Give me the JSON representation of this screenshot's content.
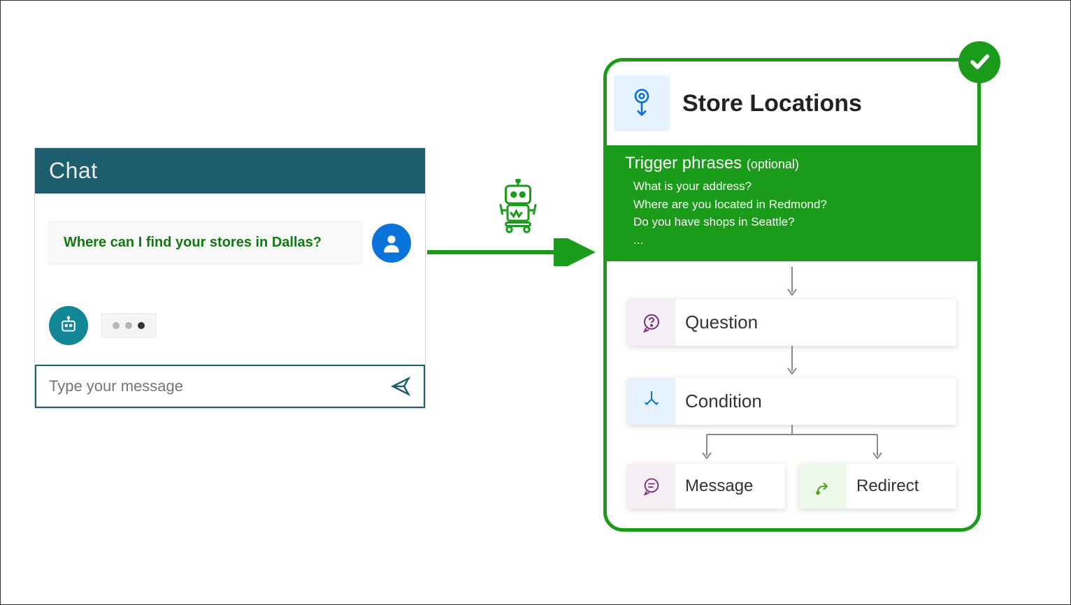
{
  "chat": {
    "title": "Chat",
    "user_message": "Where can I find your stores in Dallas?",
    "input_placeholder": "Type your message"
  },
  "flow": {
    "title": "Store Locations",
    "trigger_heading": "Trigger phrases",
    "trigger_optional": "(optional)",
    "triggers": [
      "What is your address?",
      "Where are you located in Redmond?",
      "Do you have shops in Seattle?",
      "..."
    ],
    "nodes": {
      "question": "Question",
      "condition": "Condition",
      "message": "Message",
      "redirect": "Redirect"
    }
  },
  "icons": {
    "user": "user",
    "bot": "bot",
    "send": "send",
    "robot": "robot",
    "trigger": "trigger",
    "question": "question",
    "condition": "condition",
    "message": "message",
    "redirect": "redirect",
    "check": "check"
  }
}
